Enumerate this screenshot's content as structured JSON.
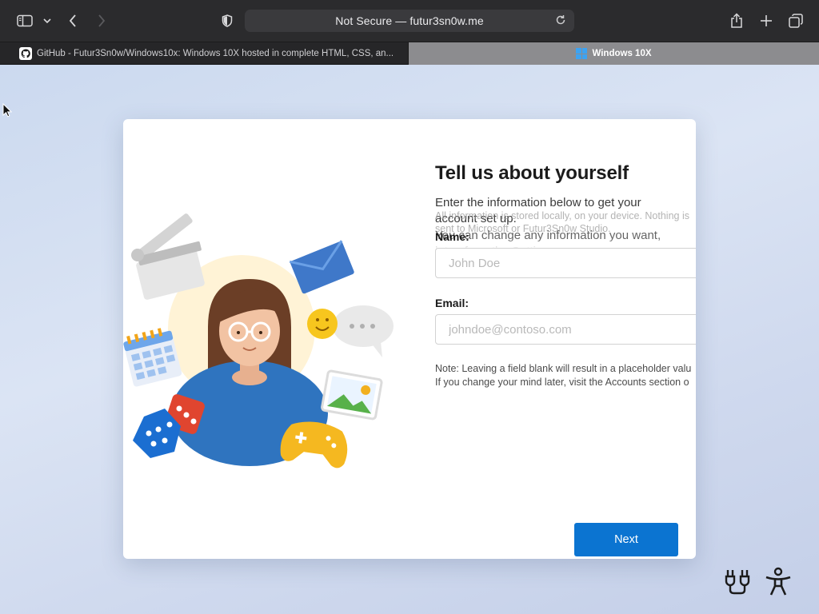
{
  "browser": {
    "address": "Not Secure — futur3sn0w.me",
    "tabs": [
      {
        "label": "GitHub - Futur3Sn0w/Windows10x: Windows 10X hosted in complete HTML, CSS, an..."
      },
      {
        "label": "Windows 10X"
      }
    ],
    "icons": [
      "sidebar-icon",
      "chevron-down-icon",
      "back-icon",
      "forward-icon",
      "shield-icon",
      "reload-icon",
      "share-icon",
      "new-tab-icon",
      "tab-overview-icon"
    ]
  },
  "setup": {
    "title": "Tell us about yourself",
    "subtitle": "Enter the information below to get your account set up.",
    "privacy_note": "All information is stored locally, on your device. Nothing is sent to Microsoft or Futur3Sn0w Studio.",
    "change_note": "You can change any information you want, later, from the Settings.",
    "name_label": "Name:",
    "name_placeholder": "John Doe",
    "name_value": "",
    "email_label": "Email:",
    "email_placeholder": "johndoe@contoso.com",
    "email_value": "",
    "note_line1": "Note: Leaving a field blank will result in a placeholder valu",
    "note_line2": "If you change your mind later, visit the Accounts section o",
    "next_label": "Next"
  },
  "colors": {
    "accent": "#0b74d1",
    "toolbar": "#2b2b2d",
    "active_tab": "#8c8c8f"
  },
  "corner_icons": [
    "connectivity-icon",
    "accessibility-icon"
  ]
}
